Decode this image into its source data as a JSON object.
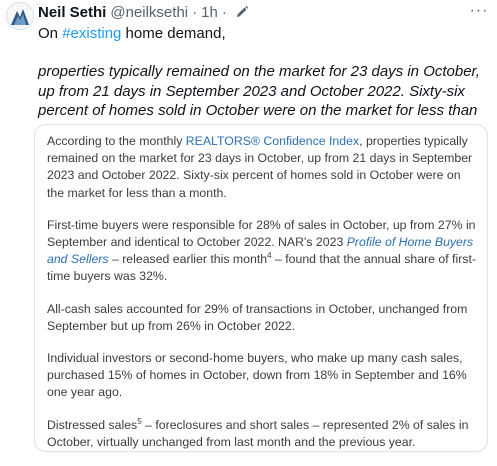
{
  "tweet": {
    "author_name": "Neil Sethi",
    "handle": "@neilksethi",
    "separator": "·",
    "time": "1h",
    "separator2": "·",
    "more_glyph": "···",
    "text_prefix": "On ",
    "hashtag": "#existing",
    "text_suffix": " home demand,",
    "italic_quote": "properties typically remained on the market for 23 days in October, up from 21 days in September 2023 and October 2022. Sixty-six percent of homes sold in October were on the market for less than a month."
  },
  "card": {
    "p1_a": "According to the monthly ",
    "p1_link": "REALTORS® Confidence Index",
    "p1_b": ", properties typically remained on the market for 23 days in October, up from 21 days in September 2023 and October 2022. Sixty-six percent of homes sold in October were on the market for less than a month.",
    "p2_a": "First-time buyers were responsible for 28% of sales in October, up from 27% in September and identical to October 2022. NAR's 2023 ",
    "p2_link": "Profile of Home Buyers and Sellers",
    "p2_b": " – released earlier this month",
    "p2_sup": "4",
    "p2_c": " – found that the annual share of first-time buyers was 32%.",
    "p3": "All-cash sales accounted for 29% of transactions in October, unchanged from September but up from 26% in October 2022.",
    "p4": "Individual investors or second-home buyers, who make up many cash sales, purchased 15% of homes in October, down from 18% in September and 16% one year ago.",
    "p5_a": "Distressed sales",
    "p5_sup": "5",
    "p5_b": " – foreclosures and short sales – represented 2% of sales in October, virtually unchanged from last month and the previous year."
  },
  "colors": {
    "link": "#1d9bf0",
    "card_link": "#2b6fb4",
    "muted": "#536471"
  },
  "icons": {
    "avatar": "avatar-icon",
    "edit": "pencil-icon",
    "more": "more-icon"
  }
}
